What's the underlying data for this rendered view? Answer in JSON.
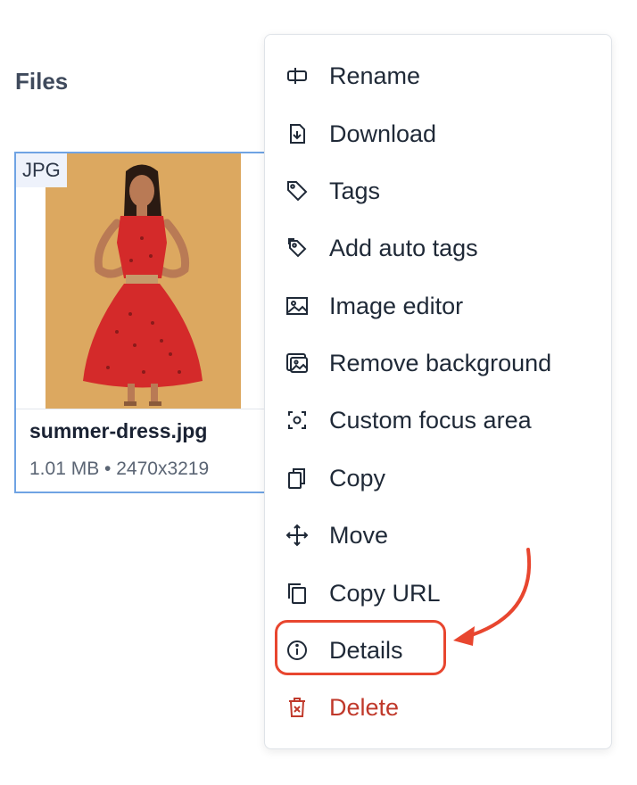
{
  "section": {
    "title": "Files"
  },
  "file": {
    "type": "JPG",
    "name": "summer-dress.jpg",
    "meta": "1.01 MB • 2470x3219"
  },
  "menu": {
    "items": [
      {
        "label": "Rename",
        "icon": "rename-icon"
      },
      {
        "label": "Download",
        "icon": "download-icon"
      },
      {
        "label": "Tags",
        "icon": "tag-icon"
      },
      {
        "label": "Add auto tags",
        "icon": "auto-tag-icon"
      },
      {
        "label": "Image editor",
        "icon": "image-editor-icon"
      },
      {
        "label": "Remove background",
        "icon": "remove-background-icon"
      },
      {
        "label": "Custom focus area",
        "icon": "focus-area-icon"
      },
      {
        "label": "Copy",
        "icon": "copy-icon"
      },
      {
        "label": "Move",
        "icon": "move-icon"
      },
      {
        "label": "Copy URL",
        "icon": "copy-url-icon"
      },
      {
        "label": "Details",
        "icon": "info-icon",
        "highlighted": true
      },
      {
        "label": "Delete",
        "icon": "delete-icon",
        "danger": true
      }
    ]
  },
  "colors": {
    "accent": "#6fa3e3",
    "danger": "#c0392b",
    "annotation": "#e8462f",
    "photo_background": "#dca860",
    "dress": "#d42a2a"
  }
}
